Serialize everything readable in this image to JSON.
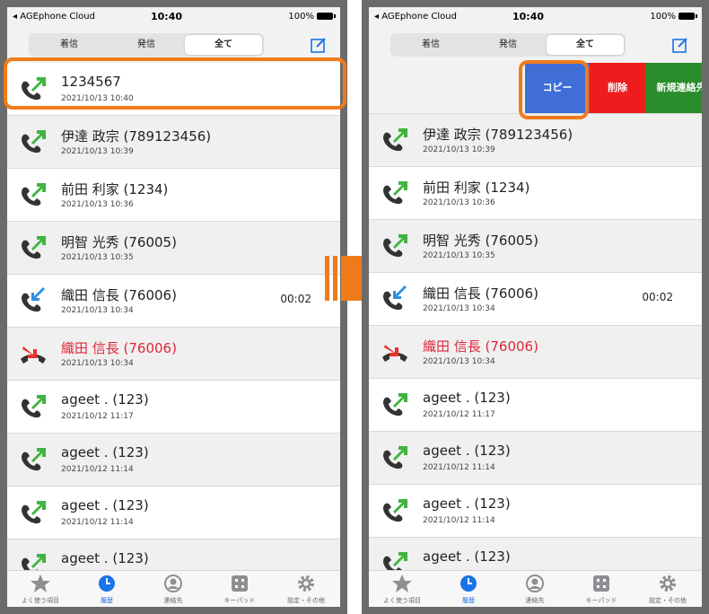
{
  "status": {
    "carrier": "◂ AGEphone Cloud",
    "time": "10:40",
    "battery": "100%"
  },
  "segments": [
    "着信",
    "発信",
    "全て"
  ],
  "active_segment": 2,
  "calls": [
    {
      "name": "1234567",
      "date": "2021/10/13 10:40",
      "type": "outgoing",
      "duration": ""
    },
    {
      "name": "伊達 政宗 (789123456)",
      "date": "2021/10/13 10:39",
      "type": "outgoing",
      "duration": ""
    },
    {
      "name": "前田 利家 (1234)",
      "date": "2021/10/13 10:36",
      "type": "outgoing",
      "duration": ""
    },
    {
      "name": "明智 光秀 (76005)",
      "date": "2021/10/13 10:35",
      "type": "outgoing",
      "duration": ""
    },
    {
      "name": "織田 信長 (76006)",
      "date": "2021/10/13 10:34",
      "type": "incoming",
      "duration": "00:02"
    },
    {
      "name": "織田 信長 (76006)",
      "date": "2021/10/13 10:34",
      "type": "missed",
      "duration": ""
    },
    {
      "name": "ageet . (123)",
      "date": "2021/10/12 11:17",
      "type": "outgoing",
      "duration": ""
    },
    {
      "name": "ageet . (123)",
      "date": "2021/10/12 11:14",
      "type": "outgoing",
      "duration": ""
    },
    {
      "name": "ageet . (123)",
      "date": "2021/10/12 11:14",
      "type": "outgoing",
      "duration": ""
    },
    {
      "name": "ageet . (123)",
      "date": "",
      "type": "outgoing",
      "duration": ""
    }
  ],
  "swipe_actions": {
    "copy": "コピー",
    "delete": "削除",
    "new_contact": "新規連絡先"
  },
  "tabs": [
    {
      "label": "よく使う項目",
      "icon": "star-icon"
    },
    {
      "label": "履歴",
      "icon": "clock-icon"
    },
    {
      "label": "連絡先",
      "icon": "person-icon"
    },
    {
      "label": "キーパッド",
      "icon": "keypad-icon"
    },
    {
      "label": "設定・その他",
      "icon": "gear-icon"
    }
  ],
  "active_tab": 1,
  "colors": {
    "highlight": "#f07a1a",
    "copy": "#3e6ed6",
    "delete": "#ee1c1c",
    "new_contact": "#2a8c2a",
    "missed_text": "#e0263a",
    "active_tab": "#1a73e8"
  }
}
